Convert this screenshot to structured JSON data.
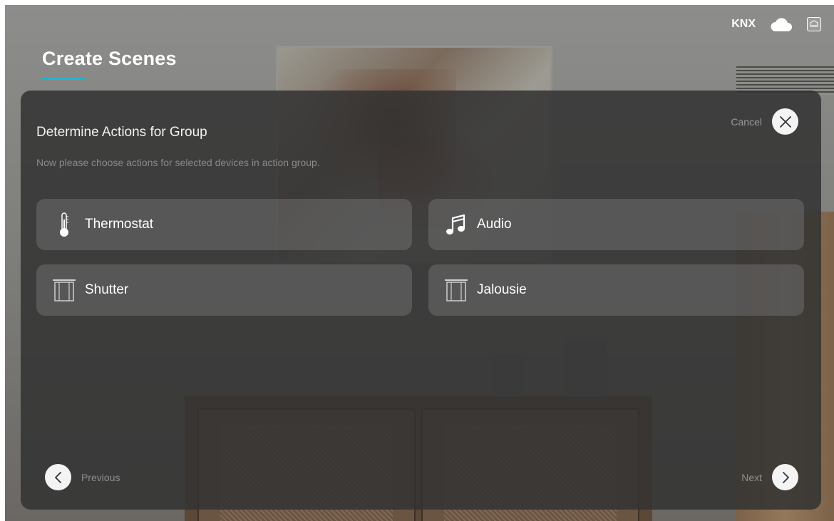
{
  "page": {
    "title": "Create Scenes",
    "accent_color": "#19b6d4"
  },
  "statusbar": {
    "protocol_label": "KNX",
    "icons": [
      "cloud-icon",
      "gateway-icon"
    ]
  },
  "dialog": {
    "title": "Determine Actions for Group",
    "subtitle": "Now please choose actions for selected devices in action group.",
    "cancel_label": "Cancel",
    "cancel_icon": "close-icon",
    "devices": [
      {
        "label": "Thermostat",
        "icon": "thermometer-icon"
      },
      {
        "label": "Audio",
        "icon": "music-note-icon"
      },
      {
        "label": "Shutter",
        "icon": "shutter-icon"
      },
      {
        "label": "Jalousie",
        "icon": "jalousie-icon"
      }
    ],
    "previous_label": "Previous",
    "next_label": "Next"
  }
}
